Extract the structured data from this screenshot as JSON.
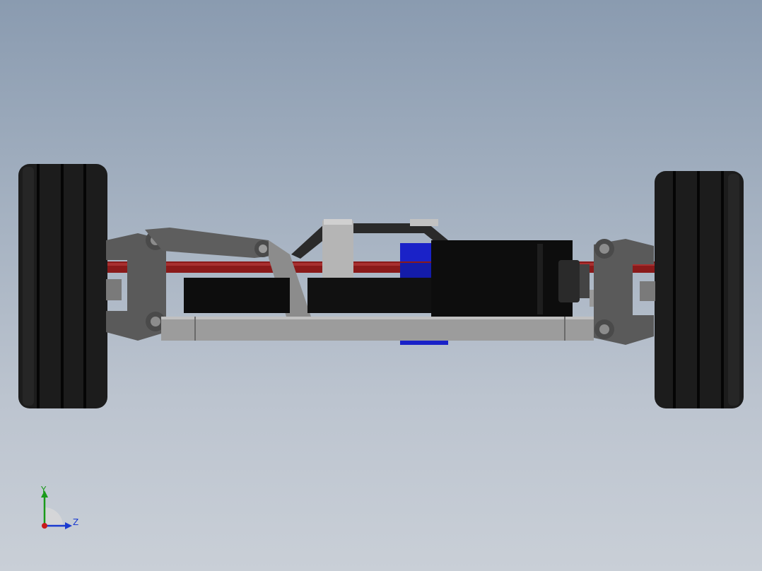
{
  "viewport": {
    "background_top": "#8a9bb0",
    "background_bottom": "#c9cfd7"
  },
  "model": {
    "colors": {
      "tire": "#1c1c1c",
      "tire_groove": "#050505",
      "aluminum": "#8c8c8c",
      "aluminum_light": "#a8a8a8",
      "aluminum_dark": "#5a5a5a",
      "bracket": "#2a2a2a",
      "motor": "#0d0d0d",
      "red_link": "#8a1a1a",
      "blue_part": "#1a22c8",
      "shaft": "#b5b5b5"
    }
  },
  "triad": {
    "y_label": "Y",
    "z_label": "Z",
    "y_color": "#1a9a1a",
    "z_color": "#1a3ad0",
    "x_color": "#c81a1a"
  }
}
